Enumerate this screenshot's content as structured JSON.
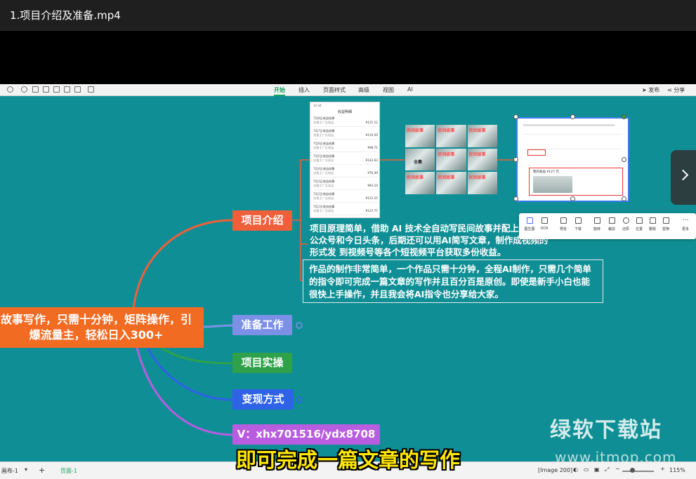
{
  "window": {
    "title": "1.项目介绍及准备.mp4"
  },
  "toolbar": {
    "tabs": [
      "开始",
      "插入",
      "页面样式",
      "高级",
      "视图",
      "AI"
    ],
    "active_tab": "开始",
    "publish_label": "发布",
    "share_label": "分享"
  },
  "mindmap": {
    "root": "故事写作，只需十分钟，矩阵操作，引爆流量主，轻松日入300+",
    "nodes": {
      "intro": "项目介绍",
      "prep": "准备工作",
      "practice": "项目实操",
      "monetize": "变现方式",
      "contact": "V：xhx701516/ydx8708"
    },
    "intro_desc": "项目原理简单，借助 AI 技术全自动写民间故事并配上几 布到公众号和今日头条，后期还可以用AI简写文章，制作成视频的形式发 到视频号等各个短视频平台获取多份收益。",
    "intro_desc_box": "作品的制作非常简单，一个作品只需十分钟，全程AI制作，只需几个简单的指令即可完成一篇文章的写作并且百分百是原创。即使是新手小白也能很快上手操作，并且我会将AI指令也分享给大家。"
  },
  "phone": {
    "status": "12:34",
    "title": "收益明细",
    "rows": [
      {
        "date": "7月8日收益结算",
        "sub": "流量主广告收益",
        "amount": "¥121.12"
      },
      {
        "date": "7月7日收益结算",
        "sub": "流量主广告收益",
        "amount": "¥116.50"
      },
      {
        "date": "7月6日收益结算",
        "sub": "流量主广告收益",
        "amount": "¥98.71"
      },
      {
        "date": "7月5日收益结算",
        "sub": "流量主广告收益",
        "amount": "¥142.63"
      },
      {
        "date": "7月4日收益结算",
        "sub": "流量主广告收益",
        "amount": "¥76.49"
      },
      {
        "date": "7月3日收益结算",
        "sub": "流量主广告收益",
        "amount": "¥83.10"
      },
      {
        "date": "7月2日收益结算",
        "sub": "流量主广告收益",
        "amount": "¥111.25"
      },
      {
        "date": "7月1日收益结算",
        "sub": "流量主广告收益",
        "amount": "¥127.77"
      }
    ]
  },
  "thumbnails": [
    "民间故事",
    "民间故事",
    "民间故事",
    "全集",
    "民间故事",
    "民间故事",
    "民间故事",
    "民间故事",
    "民间故事"
  ],
  "screenshot_preview": {
    "caption": "我的收益 ¥127 元"
  },
  "float_toolbar": [
    "图生图",
    "OCR",
    "预览",
    "下载",
    "旋转",
    "裁剪",
    "还原",
    "位置",
    "删除",
    "替换",
    "更多"
  ],
  "statusbar": {
    "sheet": "画布-1",
    "page": "页面-1",
    "image_label": "[Image 200]",
    "zoom": "115%"
  },
  "watermark": {
    "text": "绿软下载站",
    "url": "www.itmop.com"
  },
  "subtitle": "即可完成一篇文章的写作",
  "colors": {
    "canvas": "#0f8f95",
    "root": "#f26b22",
    "intro": "#ef5f3a",
    "prep": "#7c91e6",
    "practice": "#2ea14a",
    "monetize": "#2f62e6",
    "contact": "#b85ce0",
    "subtitle": "#ffe800"
  }
}
